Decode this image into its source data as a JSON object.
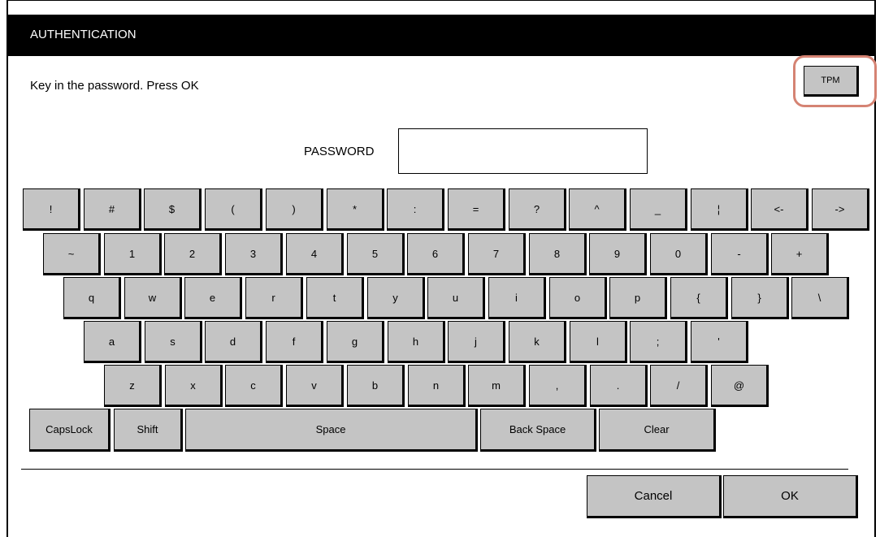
{
  "title": "AUTHENTICATION",
  "prompt": "Key in the password. Press OK",
  "tpm_label": "TPM",
  "password": {
    "label": "PASSWORD",
    "value": ""
  },
  "keyboard": {
    "rows": [
      [
        "!",
        "#",
        "$",
        "(",
        ")",
        "*",
        ":",
        "=",
        "?",
        "^",
        "_",
        "¦",
        "<-",
        "->"
      ],
      [
        "~",
        "1",
        "2",
        "3",
        "4",
        "5",
        "6",
        "7",
        "8",
        "9",
        "0",
        "-",
        "+"
      ],
      [
        "q",
        "w",
        "e",
        "r",
        "t",
        "y",
        "u",
        "i",
        "o",
        "p",
        "{",
        "}",
        "\\"
      ],
      [
        "a",
        "s",
        "d",
        "f",
        "g",
        "h",
        "j",
        "k",
        "l",
        ";",
        "'"
      ],
      [
        "z",
        "x",
        "c",
        "v",
        "b",
        "n",
        "m",
        ",",
        ".",
        "/",
        "@"
      ]
    ],
    "bottom": {
      "capslock": "CapsLock",
      "shift": "Shift",
      "space": "Space",
      "backspace": "Back Space",
      "clear": "Clear"
    }
  },
  "actions": {
    "cancel": "Cancel",
    "ok": "OK"
  },
  "colors": {
    "key_fill": "#c4c4c4",
    "title_bg": "#000000",
    "highlight": "#d58373"
  }
}
